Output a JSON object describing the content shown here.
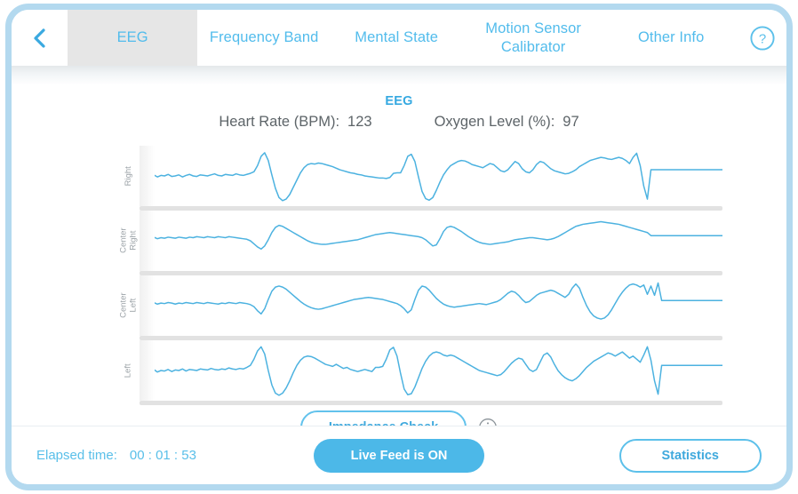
{
  "window": {
    "frame_color": "#b3d9ef",
    "accent_color": "#4cb8e8",
    "title_color": "#36a9e1"
  },
  "header": {
    "back_icon": "chevron-left-icon",
    "help_icon": "help-circle-icon",
    "tabs": [
      {
        "label": "EEG",
        "active": true
      },
      {
        "label": "Frequency Band",
        "active": false
      },
      {
        "label": "Mental State",
        "active": false
      },
      {
        "label": "Motion Sensor\nCalibrator",
        "active": false
      },
      {
        "label": "Other Info",
        "active": false
      }
    ]
  },
  "main": {
    "title": "EEG",
    "vitals": [
      {
        "label": "Heart Rate (BPM):",
        "value": "123"
      },
      {
        "label": "Oxygen Level (%):",
        "value": "97"
      }
    ],
    "impedance_button": "Impedance Check",
    "info_icon": "info-circle-icon"
  },
  "footer": {
    "elapsed_label": "Elapsed time:",
    "elapsed_value": "00 : 01 : 53",
    "live_feed_button": "Live Feed is ON",
    "statistics_button": "Statistics"
  },
  "chart_data": {
    "type": "line",
    "title": "EEG",
    "xlabel": "",
    "ylabel": "",
    "grid": false,
    "legend": "none",
    "line_color": "#4cb2e0",
    "playhead_x": 0.83,
    "series": [
      {
        "name": "Right",
        "values": [
          0.5,
          0.49,
          0.51,
          0.5,
          0.52,
          0.48,
          0.51,
          0.5,
          0.53,
          0.49,
          0.5,
          0.52,
          0.48,
          0.51,
          0.53,
          0.5,
          0.49,
          0.52,
          0.51,
          0.5,
          0.52,
          0.54,
          0.51,
          0.5,
          0.53,
          0.52,
          0.51,
          0.54,
          0.52,
          0.51,
          0.53,
          0.55,
          0.58,
          0.7,
          0.88,
          0.95,
          0.8,
          0.52,
          0.26,
          0.08,
          0.02,
          0.05,
          0.14,
          0.28,
          0.42,
          0.56,
          0.66,
          0.72,
          0.74,
          0.73,
          0.75,
          0.74,
          0.72,
          0.7,
          0.68,
          0.65,
          0.62,
          0.6,
          0.58,
          0.56,
          0.55,
          0.53,
          0.52,
          0.5,
          0.49,
          0.48,
          0.47,
          0.46,
          0.46,
          0.45,
          0.47,
          0.55,
          0.56,
          0.56,
          0.7,
          0.88,
          0.92,
          0.78,
          0.48,
          0.2,
          0.06,
          0.03,
          0.08,
          0.22,
          0.38,
          0.52,
          0.62,
          0.7,
          0.74,
          0.78,
          0.8,
          0.79,
          0.76,
          0.72,
          0.7,
          0.68,
          0.66,
          0.7,
          0.74,
          0.72,
          0.66,
          0.6,
          0.58,
          0.62,
          0.7,
          0.78,
          0.74,
          0.64,
          0.58,
          0.56,
          0.62,
          0.72,
          0.78,
          0.76,
          0.7,
          0.64,
          0.6,
          0.58,
          0.56,
          0.54,
          0.55,
          0.58,
          0.62,
          0.68,
          0.72,
          0.76,
          0.8,
          0.82,
          0.84,
          0.86,
          0.85,
          0.83,
          0.82,
          0.84,
          0.86,
          0.84,
          0.8,
          0.74,
          0.86,
          0.94,
          0.7,
          0.3,
          0.05,
          0.62,
          0.62,
          0.62,
          0.62,
          0.62,
          0.62,
          0.62,
          0.62,
          0.62,
          0.62,
          0.62,
          0.62,
          0.62,
          0.62,
          0.62,
          0.62,
          0.62,
          0.62,
          0.62,
          0.62,
          0.62
        ]
      },
      {
        "name": "Center\nRight",
        "values": [
          0.55,
          0.54,
          0.56,
          0.55,
          0.57,
          0.54,
          0.56,
          0.55,
          0.57,
          0.56,
          0.55,
          0.57,
          0.56,
          0.55,
          0.57,
          0.56,
          0.58,
          0.57,
          0.56,
          0.58,
          0.57,
          0.56,
          0.58,
          0.57,
          0.56,
          0.58,
          0.57,
          0.56,
          0.55,
          0.54,
          0.53,
          0.5,
          0.44,
          0.38,
          0.34,
          0.4,
          0.52,
          0.66,
          0.76,
          0.8,
          0.78,
          0.74,
          0.7,
          0.66,
          0.62,
          0.58,
          0.54,
          0.5,
          0.47,
          0.45,
          0.44,
          0.43,
          0.43,
          0.44,
          0.45,
          0.46,
          0.47,
          0.48,
          0.49,
          0.5,
          0.51,
          0.52,
          0.54,
          0.56,
          0.58,
          0.6,
          0.62,
          0.63,
          0.64,
          0.65,
          0.66,
          0.65,
          0.64,
          0.63,
          0.62,
          0.61,
          0.6,
          0.59,
          0.58,
          0.56,
          0.52,
          0.46,
          0.4,
          0.42,
          0.54,
          0.68,
          0.76,
          0.78,
          0.76,
          0.72,
          0.68,
          0.63,
          0.58,
          0.54,
          0.5,
          0.47,
          0.45,
          0.44,
          0.43,
          0.44,
          0.45,
          0.46,
          0.47,
          0.48,
          0.5,
          0.52,
          0.53,
          0.54,
          0.55,
          0.56,
          0.56,
          0.55,
          0.54,
          0.53,
          0.52,
          0.53,
          0.55,
          0.58,
          0.62,
          0.66,
          0.7,
          0.74,
          0.78,
          0.8,
          0.82,
          0.83,
          0.84,
          0.85,
          0.86,
          0.87,
          0.86,
          0.85,
          0.84,
          0.83,
          0.82,
          0.8,
          0.78,
          0.76,
          0.74,
          0.72,
          0.7,
          0.68,
          0.66,
          0.6,
          0.6,
          0.6,
          0.6,
          0.6,
          0.6,
          0.6,
          0.6,
          0.6,
          0.6,
          0.6,
          0.6,
          0.6,
          0.6,
          0.6,
          0.6,
          0.6,
          0.6,
          0.6,
          0.6,
          0.6
        ]
      },
      {
        "name": "Center\nLeft",
        "values": [
          0.55,
          0.53,
          0.55,
          0.54,
          0.56,
          0.53,
          0.55,
          0.54,
          0.56,
          0.55,
          0.53,
          0.55,
          0.54,
          0.56,
          0.55,
          0.54,
          0.56,
          0.55,
          0.54,
          0.56,
          0.55,
          0.54,
          0.53,
          0.55,
          0.54,
          0.56,
          0.55,
          0.54,
          0.56,
          0.55,
          0.54,
          0.52,
          0.48,
          0.4,
          0.34,
          0.44,
          0.62,
          0.78,
          0.86,
          0.88,
          0.86,
          0.82,
          0.76,
          0.7,
          0.64,
          0.58,
          0.53,
          0.49,
          0.46,
          0.44,
          0.43,
          0.44,
          0.46,
          0.48,
          0.5,
          0.52,
          0.54,
          0.56,
          0.58,
          0.6,
          0.62,
          0.63,
          0.64,
          0.65,
          0.66,
          0.65,
          0.64,
          0.63,
          0.62,
          0.6,
          0.58,
          0.56,
          0.54,
          0.5,
          0.44,
          0.36,
          0.42,
          0.62,
          0.8,
          0.88,
          0.86,
          0.8,
          0.72,
          0.64,
          0.58,
          0.53,
          0.5,
          0.48,
          0.47,
          0.48,
          0.49,
          0.5,
          0.51,
          0.52,
          0.53,
          0.54,
          0.53,
          0.52,
          0.54,
          0.56,
          0.58,
          0.62,
          0.68,
          0.74,
          0.78,
          0.76,
          0.7,
          0.62,
          0.56,
          0.58,
          0.64,
          0.7,
          0.74,
          0.76,
          0.78,
          0.8,
          0.78,
          0.74,
          0.7,
          0.66,
          0.72,
          0.84,
          0.92,
          0.84,
          0.66,
          0.5,
          0.38,
          0.3,
          0.26,
          0.24,
          0.26,
          0.32,
          0.42,
          0.54,
          0.66,
          0.76,
          0.84,
          0.9,
          0.92,
          0.9,
          0.86,
          0.9,
          0.72,
          0.88,
          0.7,
          0.94,
          0.6,
          0.6,
          0.6,
          0.6,
          0.6,
          0.6,
          0.6,
          0.6,
          0.6,
          0.6,
          0.6,
          0.6,
          0.6,
          0.6,
          0.6,
          0.6,
          0.6,
          0.6
        ]
      },
      {
        "name": "Left",
        "values": [
          0.5,
          0.48,
          0.51,
          0.49,
          0.52,
          0.47,
          0.5,
          0.49,
          0.52,
          0.48,
          0.51,
          0.5,
          0.53,
          0.49,
          0.52,
          0.51,
          0.5,
          0.53,
          0.52,
          0.51,
          0.54,
          0.52,
          0.51,
          0.53,
          0.52,
          0.55,
          0.53,
          0.52,
          0.54,
          0.53,
          0.56,
          0.6,
          0.72,
          0.88,
          0.96,
          0.82,
          0.5,
          0.22,
          0.06,
          0.02,
          0.06,
          0.16,
          0.3,
          0.46,
          0.6,
          0.7,
          0.76,
          0.78,
          0.77,
          0.74,
          0.7,
          0.66,
          0.62,
          0.6,
          0.58,
          0.62,
          0.58,
          0.54,
          0.56,
          0.52,
          0.5,
          0.48,
          0.5,
          0.52,
          0.5,
          0.48,
          0.56,
          0.56,
          0.58,
          0.72,
          0.9,
          0.95,
          0.78,
          0.44,
          0.14,
          0.03,
          0.05,
          0.18,
          0.36,
          0.54,
          0.68,
          0.78,
          0.84,
          0.86,
          0.84,
          0.8,
          0.78,
          0.8,
          0.78,
          0.74,
          0.7,
          0.66,
          0.62,
          0.58,
          0.54,
          0.5,
          0.48,
          0.46,
          0.44,
          0.42,
          0.4,
          0.42,
          0.48,
          0.56,
          0.64,
          0.7,
          0.74,
          0.72,
          0.62,
          0.52,
          0.48,
          0.52,
          0.66,
          0.8,
          0.84,
          0.76,
          0.62,
          0.5,
          0.42,
          0.36,
          0.32,
          0.3,
          0.34,
          0.4,
          0.48,
          0.56,
          0.62,
          0.68,
          0.72,
          0.76,
          0.8,
          0.84,
          0.82,
          0.78,
          0.82,
          0.86,
          0.8,
          0.74,
          0.78,
          0.72,
          0.66,
          0.8,
          0.96,
          0.7,
          0.3,
          0.04,
          0.6,
          0.6,
          0.6,
          0.6,
          0.6,
          0.6,
          0.6,
          0.6,
          0.6,
          0.6,
          0.6,
          0.6,
          0.6,
          0.6,
          0.6,
          0.6,
          0.6,
          0.6
        ]
      }
    ]
  }
}
